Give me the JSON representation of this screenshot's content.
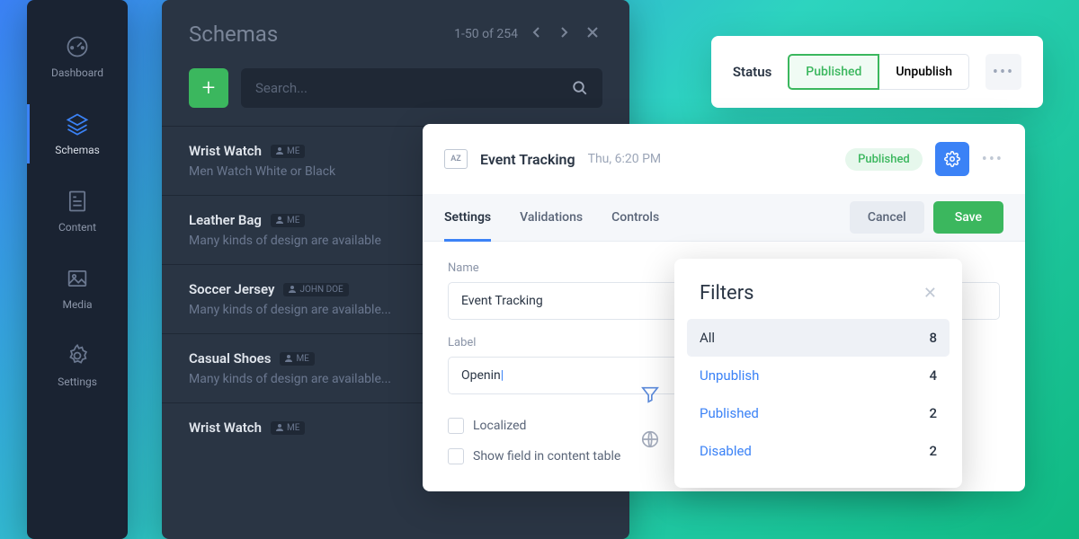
{
  "sidebar": {
    "items": [
      {
        "label": "Dashboard"
      },
      {
        "label": "Schemas"
      },
      {
        "label": "Content"
      },
      {
        "label": "Media"
      },
      {
        "label": "Settings"
      }
    ]
  },
  "schemas": {
    "title": "Schemas",
    "pagination": "1-50 of 254",
    "search_placeholder": "Search...",
    "items": [
      {
        "title": "Wrist Watch",
        "author": "ME",
        "desc": "Men Watch White or Black"
      },
      {
        "title": "Leather Bag",
        "author": "ME",
        "desc": "Many kinds of design are available"
      },
      {
        "title": "Soccer Jersey",
        "author": "JOHN DOE",
        "desc": "Many kinds of design are available..."
      },
      {
        "title": "Casual Shoes",
        "author": "ME",
        "desc": "Many kinds of design are available..."
      },
      {
        "title": "Wrist Watch",
        "author": "ME",
        "desc": ""
      }
    ]
  },
  "status_bar": {
    "label": "Status",
    "published": "Published",
    "unpublish": "Unpublish"
  },
  "detail": {
    "az": "AZ",
    "title": "Event Tracking",
    "time": "Thu, 6:20 PM",
    "published_badge": "Published",
    "tabs": {
      "settings": "Settings",
      "validations": "Validations",
      "controls": "Controls"
    },
    "cancel": "Cancel",
    "save": "Save",
    "fields": {
      "name_label": "Name",
      "name_value": "Event Tracking",
      "label_label": "Label",
      "label_value": "Openin",
      "localized": "Localized",
      "show_in_table": "Show field in content table"
    }
  },
  "filters": {
    "title": "Filters",
    "items": [
      {
        "name": "All",
        "count": "8"
      },
      {
        "name": "Unpublish",
        "count": "4"
      },
      {
        "name": "Published",
        "count": "2"
      },
      {
        "name": "Disabled",
        "count": "2"
      }
    ]
  }
}
